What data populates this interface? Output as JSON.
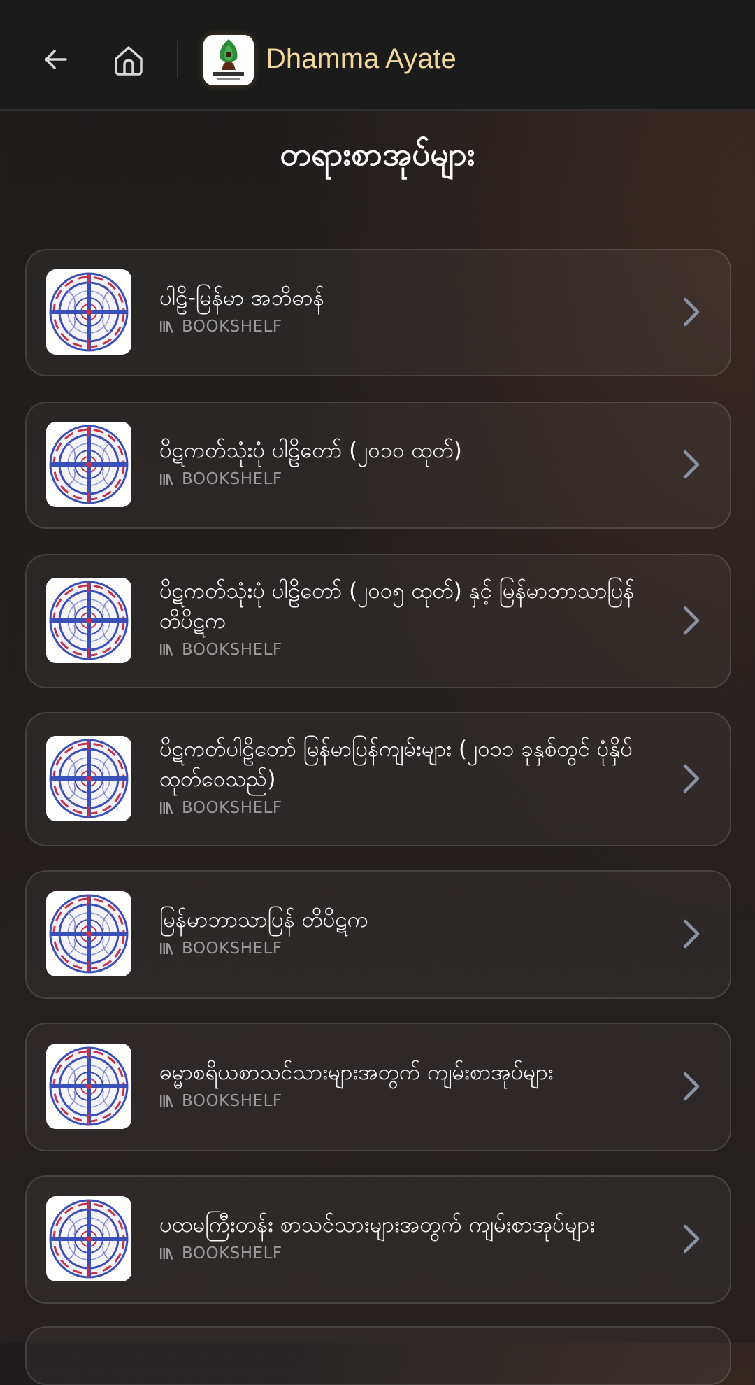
{
  "header": {
    "app_title": "Dhamma Ayate",
    "back_icon": "arrow-left-icon",
    "home_icon": "home-icon"
  },
  "page": {
    "title": "တရားစာအုပ်များ"
  },
  "colors": {
    "accent_title": "#f2d79a",
    "subtitle": "#9b9b9b",
    "chevron": "#8a93a3"
  },
  "items": [
    {
      "title": "ပါဠိ-မြန်မာ အဘိဓာန်",
      "subtitle": "BOOKSHELF"
    },
    {
      "title": "ပိဋကတ်သုံးပုံ ပါဠိတော် (၂၀၁၀ ထုတ်)",
      "subtitle": "BOOKSHELF"
    },
    {
      "title": "ပိဋကတ်သုံးပုံ ပါဠိတော် (၂၀၀၅ ထုတ်) နှင့် မြန်မာဘာသာပြန် တိပိဋက",
      "subtitle": "BOOKSHELF"
    },
    {
      "title": "ပိဋကတ်ပါဠိတော် မြန်မာပြန်ကျမ်းများ (၂၀၁၁ ခုနှစ်တွင် ပုံနှိပ်ထုတ်ဝေသည်)",
      "subtitle": "BOOKSHELF"
    },
    {
      "title": "မြန်မာဘာသာပြန် တိပိဋက",
      "subtitle": "BOOKSHELF"
    },
    {
      "title": "ဓမ္မာစရိယစာသင်သားများအတွက် ကျမ်းစာအုပ်များ",
      "subtitle": "BOOKSHELF"
    },
    {
      "title": "ပထမကြီးတန်း စာသင်သားများအတွက် ကျမ်းစာအုပ်များ",
      "subtitle": "BOOKSHELF"
    }
  ]
}
